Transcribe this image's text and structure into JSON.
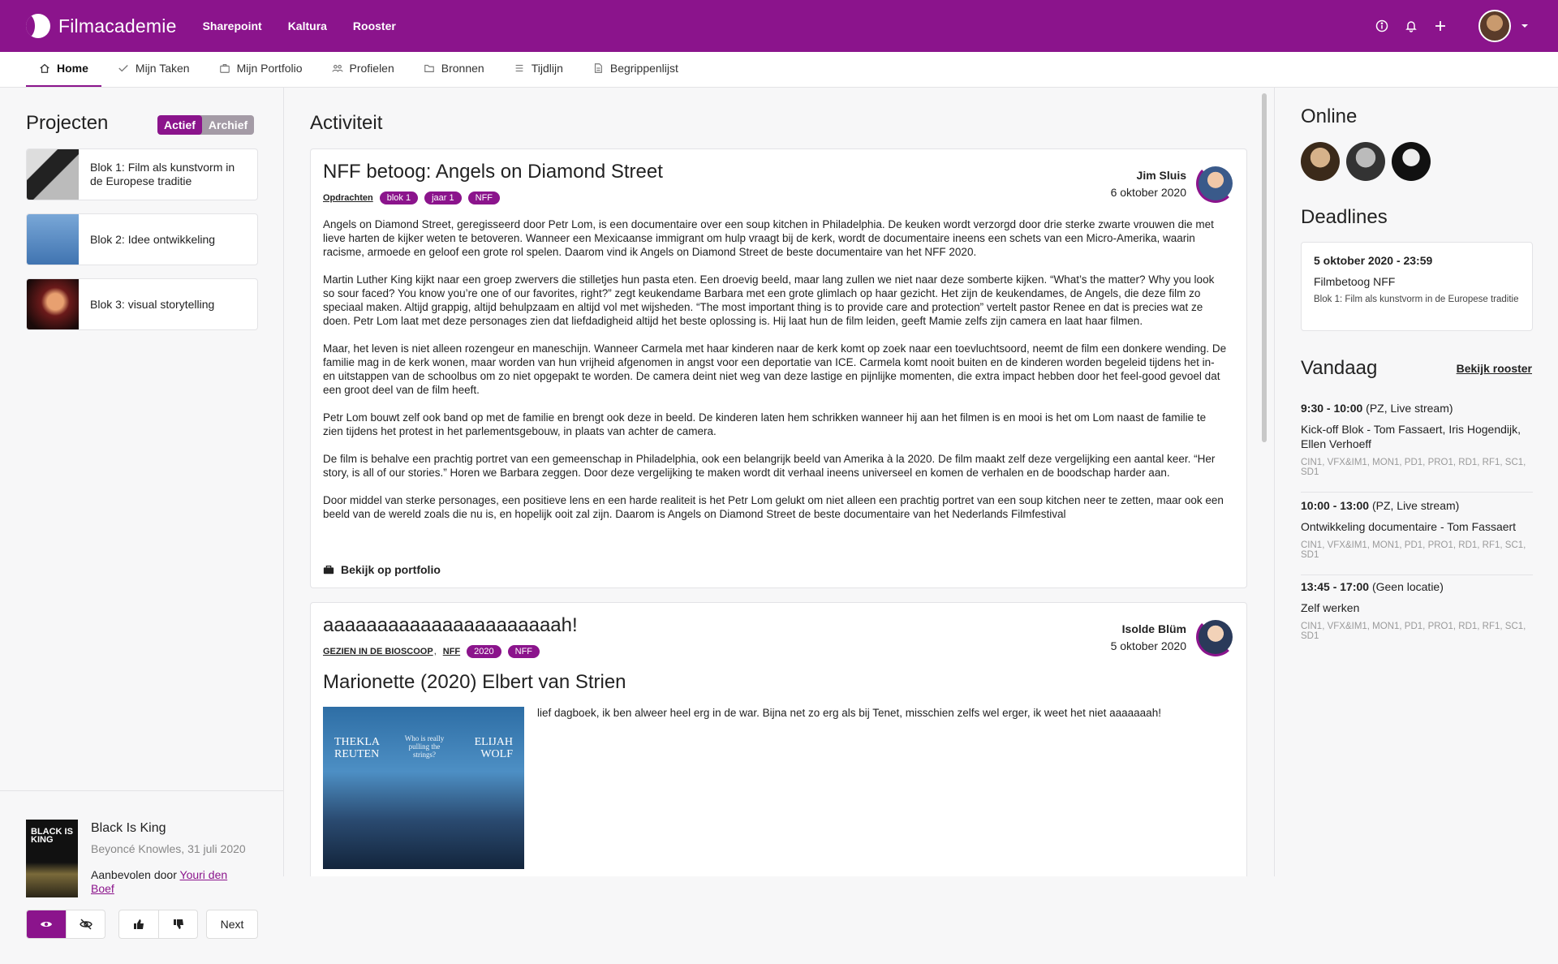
{
  "app": {
    "name": "Filmacademie",
    "topnav": [
      "Sharepoint",
      "Kaltura",
      "Rooster"
    ],
    "brand_color": "#8b148c"
  },
  "icons": {
    "info": "info-icon",
    "bell": "bell-icon",
    "plus": "plus-icon",
    "chevron": "chevron-down-icon"
  },
  "subnav": [
    {
      "label": "Home",
      "icon": "home-icon"
    },
    {
      "label": "Mijn Taken",
      "icon": "check-icon"
    },
    {
      "label": "Mijn Portfolio",
      "icon": "briefcase-icon"
    },
    {
      "label": "Profielen",
      "icon": "people-icon"
    },
    {
      "label": "Bronnen",
      "icon": "folder-icon"
    },
    {
      "label": "Tijdlijn",
      "icon": "list-icon"
    },
    {
      "label": "Begrippenlijst",
      "icon": "document-icon"
    }
  ],
  "projects": {
    "title": "Projecten",
    "toggle": [
      "Actief",
      "Archief"
    ],
    "items": [
      "Blok 1: Film als kunstvorm in de Europese traditie",
      "Blok 2: Idee ontwikkeling",
      "Blok 3: visual storytelling"
    ]
  },
  "recommendation": {
    "cover_text": "BLACK IS KING",
    "title": "Black Is King",
    "subtitle": "Beyoncé Knowles, 31 juli 2020",
    "by_prefix": "Aanbevolen door",
    "by_name": "Youri den Boef",
    "next_label": "Next"
  },
  "activity": {
    "title": "Activiteit",
    "post1": {
      "title": "NFF betoog: Angels on Diamond Street",
      "category": "Opdrachten",
      "tags": [
        "blok 1",
        "jaar 1",
        "NFF"
      ],
      "author": "Jim Sluis",
      "date": "6 oktober 2020",
      "paragraphs": [
        "Angels on Diamond Street, geregisseerd door Petr Lom, is een documentaire over een soup kitchen in Philadelphia. De keuken wordt verzorgd door drie sterke zwarte vrouwen die met lieve harten de kijker weten te betoveren. Wanneer een Mexicaanse immigrant om hulp vraagt bij de kerk, wordt de documentaire ineens een schets van een Micro-Amerika, waarin racisme, armoede en geloof een grote rol spelen. Daarom vind ik Angels on Diamond Street de beste documentaire van het NFF 2020.",
        "Martin Luther King kijkt naar een groep zwervers die stilletjes hun pasta eten. Een droevig beeld, maar lang zullen we niet naar deze somberte kijken. “What’s the matter? Why you look so sour faced? You know you’re one of our favorites, right?” zegt keukendame Barbara met een grote glimlach op haar gezicht. Het zijn de keukendames, de Angels, die deze film zo speciaal maken. Altijd grappig, altijd behulpzaam en altijd vol met wijsheden. “The most important thing is to provide care and protection” vertelt pastor Renee en dat is precies wat ze doen. Petr Lom laat met deze personages zien dat liefdadigheid altijd het beste oplossing is. Hij laat hun de film leiden, geeft Mamie zelfs zijn camera en laat haar filmen.",
        "Maar, het leven is niet alleen rozengeur en maneschijn. Wanneer Carmela met haar kinderen naar de kerk komt op zoek naar een toevluchtsoord, neemt de film een donkere wending. De familie mag in de kerk wonen, maar worden van hun vrijheid afgenomen in angst voor een deportatie van ICE. Carmela komt nooit buiten en de kinderen worden begeleid tijdens het in- en uitstappen van de schoolbus om zo niet opgepakt te worden. De camera deint niet weg van deze lastige en pijnlijke momenten, die extra impact hebben door het feel-good gevoel dat een groot deel van de film heeft.",
        "Petr Lom bouwt zelf ook band op met de familie en brengt ook deze in beeld. De kinderen laten hem schrikken wanneer hij aan het filmen is en mooi is het om Lom naast de familie te zien tijdens het protest in het parlementsgebouw, in plaats van achter de camera.",
        "De film is behalve een prachtig portret van een gemeenschap in Philadelphia, ook een belangrijk beeld van Amerika à la 2020. De film maakt zelf deze vergelijking een aantal keer. “Her story, is all of our stories.” Horen we Barbara zeggen. Door deze vergelijking te maken wordt dit verhaal ineens universeel en komen de verhalen en de boodschap harder aan.",
        "Door middel van sterke personages, een positieve lens en een harde realiteit is het Petr Lom gelukt om niet alleen een prachtig portret van een soup kitchen neer te zetten, maar ook een beeld van de wereld zoals die nu is, en hopelijk ooit zal zijn. Daarom is Angels on Diamond Street de beste documentaire van het Nederlands Filmfestival"
      ],
      "portfolio_link": "Bekijk op portfolio"
    },
    "post2": {
      "title": "aaaaaaaaaaaaaaaaaaaaaah!",
      "categories": [
        "GEZIEN IN DE BIOSCOOP",
        "NFF"
      ],
      "tags": [
        "2020",
        "NFF"
      ],
      "author": "Isolde Blüm",
      "date": "5 oktober 2020",
      "subtitle": "Marionette (2020) Elbert van Strien",
      "poster": {
        "left_name": "THEKLA\nREUTEN",
        "right_name": "ELIJAH\nWOLF",
        "tagline": "Who is really pulling the strings?"
      },
      "text": "lief dagboek, ik ben alweer heel erg in de war. Bijna net zo erg als bij Tenet, misschien zelfs wel erger, ik weet het niet aaaaaaah!"
    }
  },
  "online": {
    "title": "Online"
  },
  "deadlines": {
    "title": "Deadlines",
    "item": {
      "date": "5 oktober 2020 - 23:59",
      "title": "Filmbetoog NFF",
      "project": "Blok 1: Film als kunstvorm in de Europese traditie"
    }
  },
  "today": {
    "title": "Vandaag",
    "link": "Bekijk rooster",
    "events": [
      {
        "time": "9:30 - 10:00",
        "location": "(PZ, Live stream)",
        "title": "Kick-off Blok - Tom Fassaert, Iris Hogendijk, Ellen Verhoeff",
        "codes": "CIN1, VFX&IM1, MON1, PD1, PRO1, RD1, RF1, SC1, SD1"
      },
      {
        "time": "10:00 - 13:00",
        "location": "(PZ, Live stream)",
        "title": "Ontwikkeling documentaire - Tom Fassaert",
        "codes": "CIN1, VFX&IM1, MON1, PD1, PRO1, RD1, RF1, SC1, SD1"
      },
      {
        "time": "13:45 - 17:00",
        "location": "(Geen locatie)",
        "title": "Zelf werken",
        "codes": "CIN1, VFX&IM1, MON1, PD1, PRO1, RD1, RF1, SC1, SD1"
      }
    ]
  }
}
